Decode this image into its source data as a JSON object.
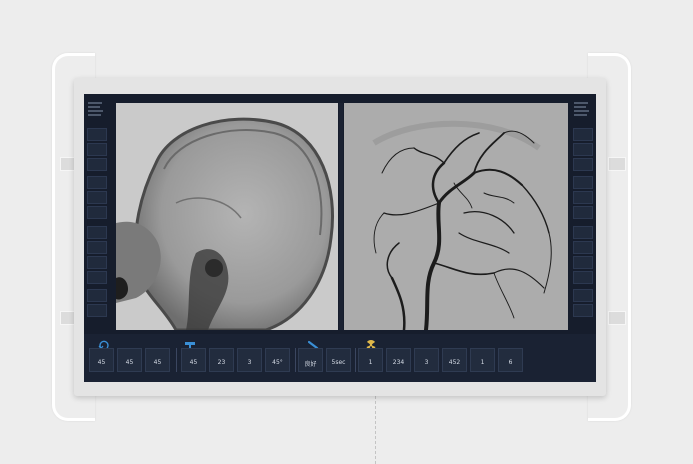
{
  "status": {
    "text": ""
  },
  "controls": [
    {
      "label": "",
      "value": "45"
    },
    {
      "label": "",
      "value": "45"
    },
    {
      "label": "",
      "value": "45"
    },
    {
      "label": "",
      "value": "45"
    },
    {
      "label": "",
      "value": "23"
    },
    {
      "label": "",
      "value": "3"
    },
    {
      "label": "",
      "value": "45°"
    },
    {
      "label": "",
      "value": "良好"
    },
    {
      "label": "",
      "value": "5sec"
    },
    {
      "label": "",
      "value": "1"
    },
    {
      "label": "",
      "value": "234"
    },
    {
      "label": "",
      "value": "3"
    },
    {
      "label": "",
      "value": "452"
    },
    {
      "label": "",
      "value": "1"
    },
    {
      "label": "",
      "value": "6"
    }
  ],
  "colors": {
    "accent": "#3a8fd6",
    "radiation": "#e0b84a",
    "panel": "#161d2c"
  }
}
